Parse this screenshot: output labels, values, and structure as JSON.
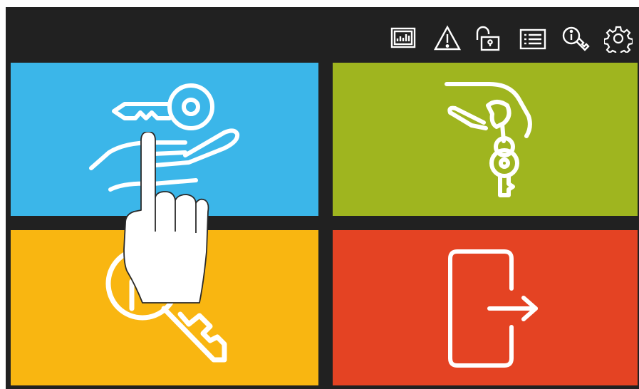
{
  "toolbar": {
    "icons": [
      {
        "name": "report-icon"
      },
      {
        "name": "warning-icon"
      },
      {
        "name": "unlock-icon"
      },
      {
        "name": "list-icon"
      },
      {
        "name": "key-info-icon"
      },
      {
        "name": "settings-icon"
      }
    ]
  },
  "tiles": [
    {
      "name": "take-key-tile",
      "icon": "hand-receiving-key-icon",
      "color": "#3bb6e9"
    },
    {
      "name": "return-key-tile",
      "icon": "hand-holding-key-icon",
      "color": "#9fb51f"
    },
    {
      "name": "key-access-tile",
      "icon": "key-icon",
      "color": "#f9b611"
    },
    {
      "name": "logout-tile",
      "icon": "logout-door-icon",
      "color": "#e44323"
    }
  ],
  "colors": {
    "background": "#212121",
    "icon_stroke": "#ffffff"
  }
}
